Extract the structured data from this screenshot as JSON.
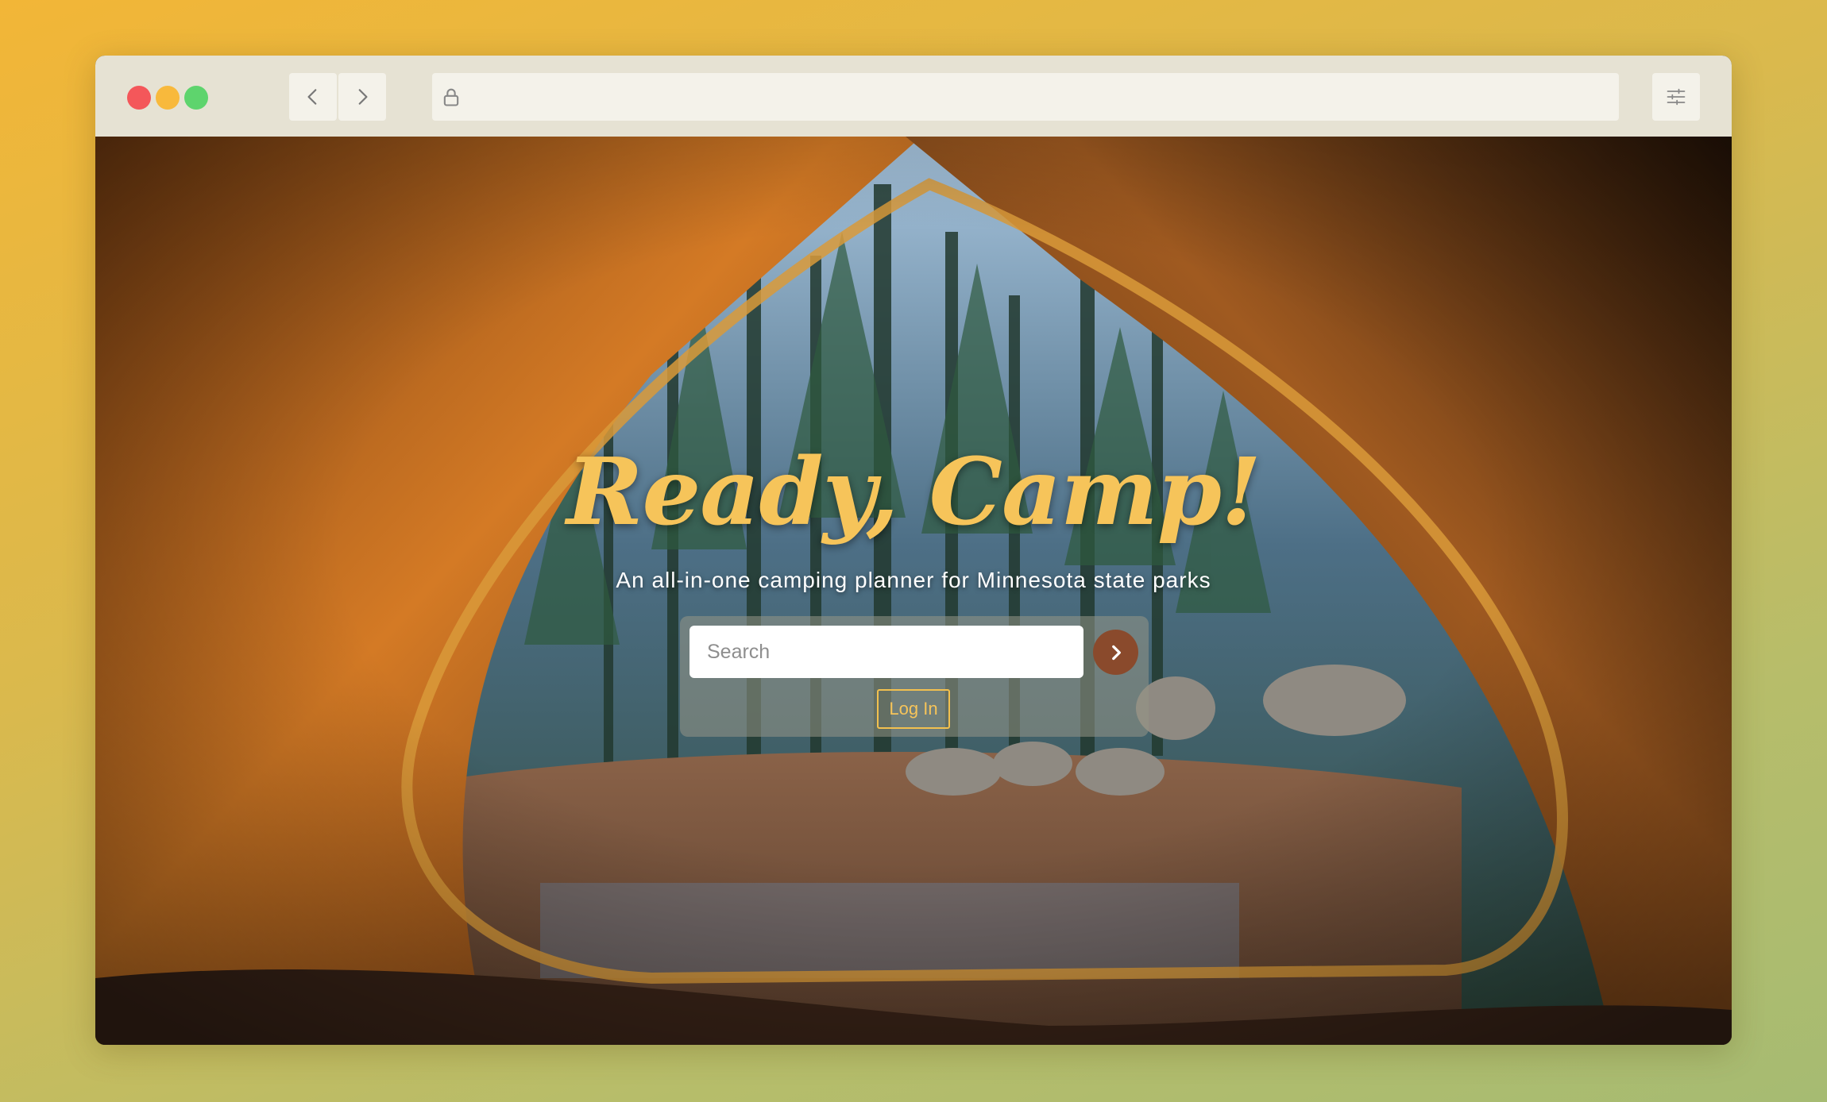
{
  "browser": {
    "window_controls": [
      "close",
      "minimize",
      "maximize"
    ],
    "nav": {
      "back_icon": "chevron-left-icon",
      "forward_icon": "chevron-right-icon"
    },
    "address_bar": {
      "url": "",
      "icon": "lock-icon"
    },
    "settings_icon": "sliders-icon"
  },
  "hero": {
    "title": "Ready, Camp!",
    "subtitle": "An all-in-one camping planner for Minnesota state parks",
    "background": "tent-doorway-forest-photo"
  },
  "search": {
    "placeholder": "Search",
    "value": "",
    "submit_icon": "chevron-right-icon"
  },
  "auth": {
    "login_label": "Log In"
  },
  "colors": {
    "accent_gold": "#f6c45a",
    "button_brown": "#8a4a2c",
    "chrome_bg": "#e6e2d3"
  }
}
